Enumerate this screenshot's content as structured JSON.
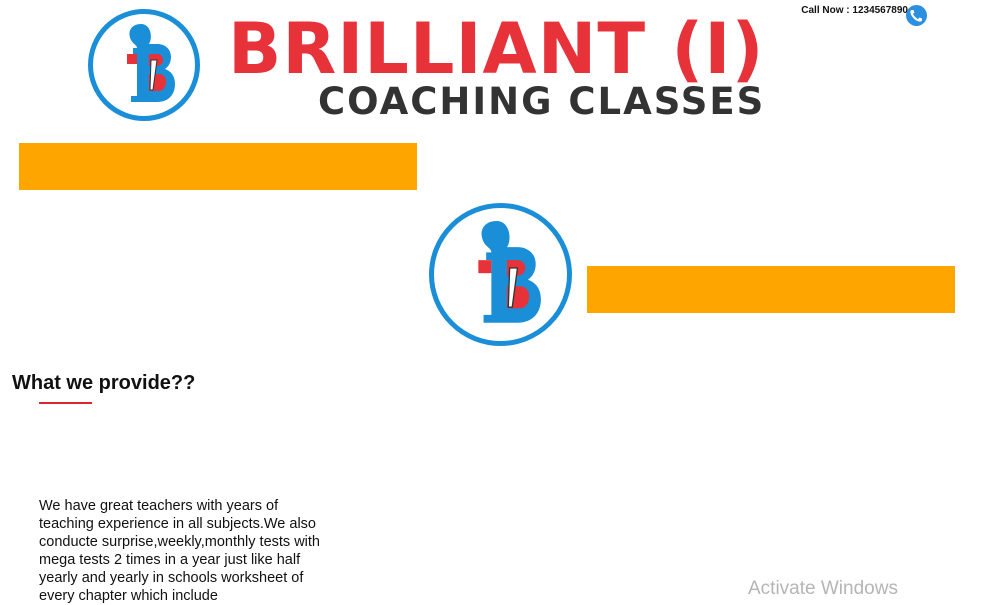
{
  "header": {
    "brand_title": "BRILLIANT (I)",
    "brand_subtitle": "COACHING CLASSES",
    "call_now": "Call Now : 1234567890",
    "logo_icon": "brilliant-logo-icon",
    "phone_icon": "phone-icon"
  },
  "colors": {
    "brand_red": "#e8323a",
    "brand_blue": "#1a8fd8",
    "bar_orange": "#ffa500",
    "text_dark": "#333333"
  },
  "section": {
    "title": "What we provide??",
    "description": "We have great teachers with years of teaching experience in all subjects.We also conducte surprise,weekly,monthly tests with mega tests 2 times in a year just like half yearly and yearly in schools worksheet of every chapter which include"
  },
  "watermark": {
    "text": "Activate Windows"
  }
}
